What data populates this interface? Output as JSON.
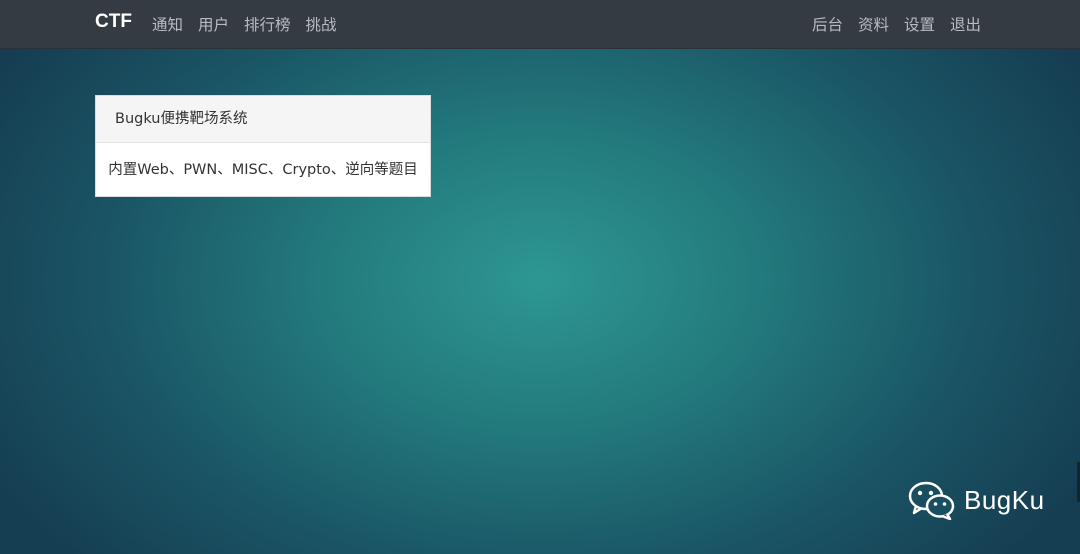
{
  "navbar": {
    "brand": "CTF",
    "left_items": [
      {
        "label": "通知"
      },
      {
        "label": "用户"
      },
      {
        "label": "排行榜"
      },
      {
        "label": "挑战"
      }
    ],
    "right_items": [
      {
        "label": "后台"
      },
      {
        "label": "资料"
      },
      {
        "label": "设置"
      },
      {
        "label": "退出"
      }
    ]
  },
  "card": {
    "header": "Bugku便携靶场系统",
    "body": "内置Web、PWN、MISC、Crypto、逆向等题目"
  },
  "watermark": {
    "icon": "wechat-icon",
    "text": "BugKu"
  },
  "colors": {
    "navbar_bg": "#353b43",
    "background_center": "#2e9793",
    "background_edge": "#163e52"
  }
}
